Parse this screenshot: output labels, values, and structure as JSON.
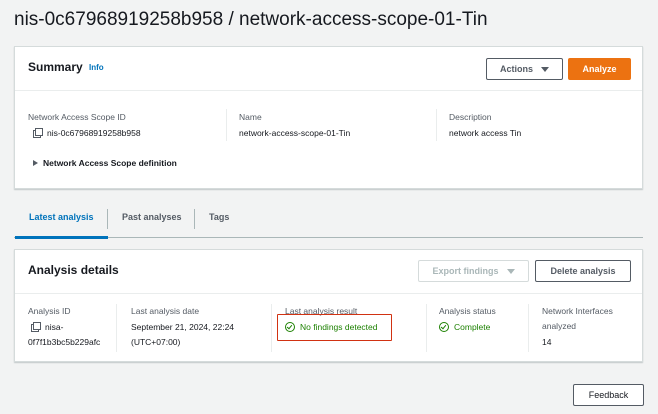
{
  "page": {
    "title": "nis-0c67968919258b958 / network-access-scope-01-Tin"
  },
  "summary": {
    "heading": "Summary",
    "info_label": "Info",
    "actions_label": "Actions",
    "analyze_label": "Analyze",
    "fields": {
      "scope_id_label": "Network Access Scope ID",
      "scope_id_value": "nis-0c67968919258b958",
      "name_label": "Name",
      "name_value": "network-access-scope-01-Tin",
      "description_label": "Description",
      "description_value": "network access Tin"
    },
    "definition_expander": "Network Access Scope definition"
  },
  "tabs": [
    {
      "label": "Latest analysis",
      "active": true
    },
    {
      "label": "Past analyses",
      "active": false
    },
    {
      "label": "Tags",
      "active": false
    }
  ],
  "analysis": {
    "heading": "Analysis details",
    "export_label": "Export findings",
    "delete_label": "Delete analysis",
    "id_label": "Analysis ID",
    "id_value_line1": "nisa-",
    "id_value_line2": "0f7f1b3bc5b229afc",
    "date_label": "Last analysis date",
    "date_value_line1": "September 21, 2024, 22:24",
    "date_value_line2": "(UTC+07:00)",
    "result_label": "Last analysis result",
    "result_value": "No findings detected",
    "status_label": "Analysis status",
    "status_value": "Complete",
    "interfaces_label_line1": "Network Interfaces",
    "interfaces_label_line2": "analyzed",
    "interfaces_value": "14"
  },
  "footer": {
    "feedback_label": "Feedback"
  },
  "colors": {
    "accent": "#0073bb",
    "primary_button": "#ec7211",
    "success": "#1d8102",
    "highlight": "#d13212"
  },
  "icons": [
    "copy-icon",
    "caret-down-icon",
    "expand-right-icon",
    "success-check-icon"
  ]
}
